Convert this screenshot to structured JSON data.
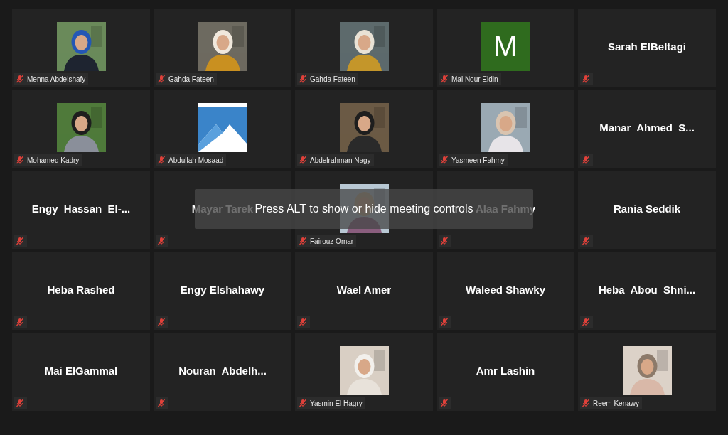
{
  "tiles": [
    {
      "name": "Menna Abdelshafy",
      "muted": true
    },
    {
      "name": "Gahda Fateen",
      "muted": true
    },
    {
      "name": "Gahda Fateen",
      "muted": true
    },
    {
      "kind": "avatar",
      "letter": "M",
      "name": "Mai Nour Eldin",
      "muted": true
    },
    {
      "kind": "name",
      "name": "Sarah ElBeltagi",
      "muted": true
    },
    {
      "name": "Mohamed Kadry",
      "muted": true
    },
    {
      "kind": "logo",
      "name": "Abdullah Mosaad",
      "muted": true
    },
    {
      "name": "Abdelrahman Nagy",
      "muted": true
    },
    {
      "name": "Yasmeen Fahmy",
      "muted": true
    },
    {
      "kind": "name",
      "name": "Manar  Ahmed  S...",
      "muted": true
    },
    {
      "kind": "name",
      "name": "Engy  Hassan  El-...",
      "muted": true
    },
    {
      "kind": "name",
      "name": "Mayar Tarek",
      "muted": true
    },
    {
      "name": "Fairouz Omar",
      "muted": true
    },
    {
      "kind": "name",
      "name": "Alaa Fahmy",
      "muted": true
    },
    {
      "kind": "name",
      "name": "Rania Seddik",
      "muted": true
    },
    {
      "kind": "name",
      "name": "Heba Rashed",
      "muted": true
    },
    {
      "kind": "name",
      "name": "Engy Elshahawy",
      "muted": true
    },
    {
      "kind": "name",
      "name": "Wael Amer",
      "muted": true
    },
    {
      "kind": "name",
      "name": "Waleed Shawky",
      "muted": true
    },
    {
      "kind": "name",
      "name": "Heba  Abou  Shni...",
      "muted": true
    },
    {
      "kind": "name",
      "name": "Mai ElGammal",
      "muted": true
    },
    {
      "kind": "name",
      "name": "Nouran  Abdelh...",
      "muted": true
    },
    {
      "name": "Yasmin El Hagry",
      "muted": true
    },
    {
      "kind": "name",
      "name": "Amr Lashin",
      "muted": true
    },
    {
      "name": "Reem Kenawy",
      "muted": true
    }
  ],
  "toast": {
    "text": "Press ALT to show or hide meeting controls"
  }
}
